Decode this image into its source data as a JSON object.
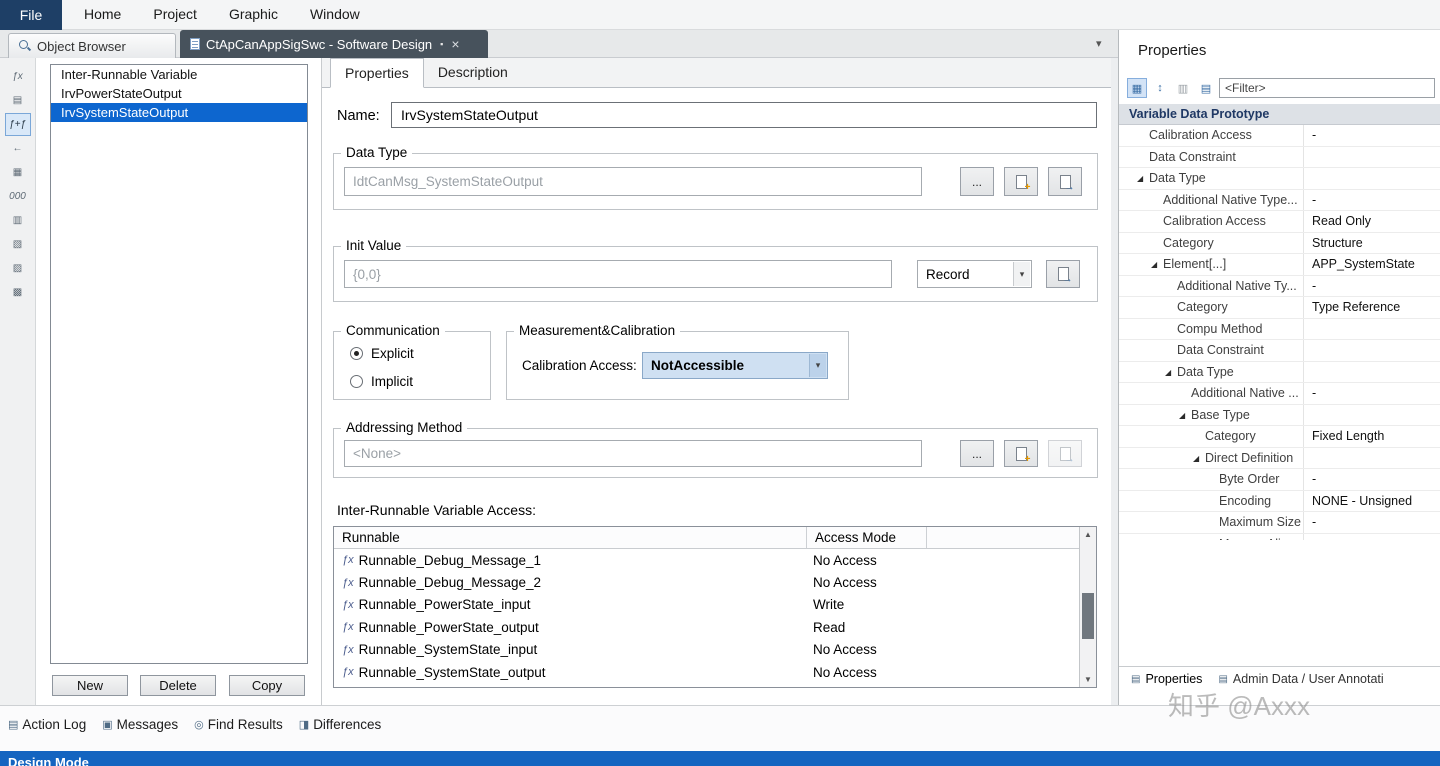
{
  "menubar": {
    "file": "File",
    "items": [
      "Home",
      "Project",
      "Graphic",
      "Window"
    ]
  },
  "tabstrip": {
    "tabs": [
      {
        "label": "Object Browser",
        "active": false
      },
      {
        "label": "CtApCanAppSigSwc - Software Design",
        "active": true
      }
    ]
  },
  "glyphs": {
    "dropdown_arrow": "▾",
    "overflow_arrow": "▾",
    "scroll_up": "▲",
    "scroll_down": "▼",
    "expand": "◢",
    "runnable_icon": "ƒx",
    "modified": "▪",
    "close": "×",
    "panel_tab_icon": "▤",
    "new_badge": "+",
    "goto_badge": "→"
  },
  "left_toolbar": {
    "icons": [
      {
        "name": "function-icon",
        "glyph": "ƒx"
      },
      {
        "name": "paste-icon",
        "glyph": "▤"
      },
      {
        "name": "inter-runnable-variable-icon",
        "glyph": "ƒ+ƒ",
        "selected": true
      },
      {
        "name": "port-icon",
        "glyph": "←"
      },
      {
        "name": "table-icon",
        "glyph": "▦"
      },
      {
        "name": "digits-icon",
        "glyph": "000"
      },
      {
        "name": "grid-icon",
        "glyph": "▥"
      },
      {
        "name": "library-icon",
        "glyph": "▧"
      },
      {
        "name": "component-icon",
        "glyph": "▨"
      },
      {
        "name": "composition-icon",
        "glyph": "▩"
      }
    ]
  },
  "object_list": {
    "items": [
      {
        "label": "Inter-Runnable Variable",
        "selected": false
      },
      {
        "label": "IrvPowerStateOutput",
        "selected": false
      },
      {
        "label": "IrvSystemStateOutput",
        "selected": true
      }
    ],
    "buttons": [
      "New",
      "Delete",
      "Copy"
    ]
  },
  "editor": {
    "tabs": [
      {
        "label": "Properties",
        "active": true
      },
      {
        "label": "Description",
        "active": false
      }
    ],
    "browse_label": "...",
    "name": {
      "label": "Name:",
      "value": "IrvSystemStateOutput"
    },
    "data_type": {
      "title": "Data Type",
      "value": "IdtCanMsg_SystemStateOutput"
    },
    "init_value": {
      "title": "Init Value",
      "value": "{0,0}",
      "type_selector": "Record"
    },
    "communication": {
      "title": "Communication",
      "options": [
        {
          "label": "Explicit",
          "selected": true
        },
        {
          "label": "Implicit",
          "selected": false
        }
      ]
    },
    "measurement": {
      "title": "Measurement&Calibration",
      "calibration_label": "Calibration Access:",
      "calibration_value": "NotAccessible"
    },
    "addressing": {
      "title": "Addressing Method",
      "value": "<None>"
    },
    "access_table": {
      "label": "Inter-Runnable Variable Access:",
      "columns": [
        "Runnable",
        "Access Mode"
      ],
      "rows": [
        {
          "runnable": "Runnable_Debug_Message_1",
          "access": "No Access"
        },
        {
          "runnable": "Runnable_Debug_Message_2",
          "access": "No Access"
        },
        {
          "runnable": "Runnable_PowerState_input",
          "access": "Write"
        },
        {
          "runnable": "Runnable_PowerState_output",
          "access": "Read"
        },
        {
          "runnable": "Runnable_SystemState_input",
          "access": "No Access"
        },
        {
          "runnable": "Runnable_SystemState_output",
          "access": "No Access"
        }
      ]
    }
  },
  "properties_panel": {
    "title": "Properties",
    "filter_placeholder": "<Filter>",
    "header": "Variable Data Prototype",
    "toolbar_icons": [
      {
        "name": "categorized-view-icon",
        "glyph": "▦",
        "active": true
      },
      {
        "name": "sort-alphabetical-icon",
        "glyph": "↕"
      },
      {
        "name": "grid-view-icon",
        "glyph": "▥",
        "disabled": true
      },
      {
        "name": "property-page-icon",
        "glyph": "▤"
      }
    ],
    "rows": [
      {
        "indent": 1,
        "key": "Calibration Access",
        "value": "-"
      },
      {
        "indent": 1,
        "key": "Data Constraint",
        "value": ""
      },
      {
        "indent": 1,
        "key": "Data Type",
        "value": "",
        "expanded": true
      },
      {
        "indent": 2,
        "key": "Additional Native Type...",
        "value": "-"
      },
      {
        "indent": 2,
        "key": "Calibration Access",
        "value": "Read Only"
      },
      {
        "indent": 2,
        "key": "Category",
        "value": "Structure"
      },
      {
        "indent": 2,
        "key": "Element[...]",
        "value": "APP_SystemState",
        "expanded": true
      },
      {
        "indent": 3,
        "key": "Additional Native Ty...",
        "value": "-"
      },
      {
        "indent": 3,
        "key": "Category",
        "value": "Type Reference"
      },
      {
        "indent": 3,
        "key": "Compu Method",
        "value": ""
      },
      {
        "indent": 3,
        "key": "Data Constraint",
        "value": ""
      },
      {
        "indent": 3,
        "key": "Data Type",
        "value": "",
        "expanded": true
      },
      {
        "indent": 4,
        "key": "Additional Native ...",
        "value": "-"
      },
      {
        "indent": 4,
        "key": "Base Type",
        "value": "",
        "expanded": true
      },
      {
        "indent": 5,
        "key": "Category",
        "value": "Fixed Length"
      },
      {
        "indent": 5,
        "key": "Direct Definition",
        "value": "",
        "expanded": true
      },
      {
        "indent": 6,
        "key": "Byte Order",
        "value": "-"
      },
      {
        "indent": 6,
        "key": "Encoding",
        "value": "NONE - Unsigned"
      },
      {
        "indent": 6,
        "key": "Maximum Size",
        "value": "-"
      },
      {
        "indent": 6,
        "key": "Memory Alig...",
        "value": ""
      }
    ],
    "bottom_tabs": [
      {
        "label": "Properties",
        "active": true
      },
      {
        "label": "Admin Data / User Annotati",
        "active": false
      }
    ]
  },
  "status_tabs": [
    {
      "label": "Action Log",
      "icon": "action-log-icon",
      "glyph": "▤"
    },
    {
      "label": "Messages",
      "icon": "messages-icon",
      "glyph": "▣"
    },
    {
      "label": "Find Results",
      "icon": "find-results-icon",
      "glyph": "◎"
    },
    {
      "label": "Differences",
      "icon": "differences-icon",
      "glyph": "◨"
    }
  ],
  "bottom_bar": {
    "label": "Design Mode"
  },
  "watermark": "知乎 @Axxx"
}
